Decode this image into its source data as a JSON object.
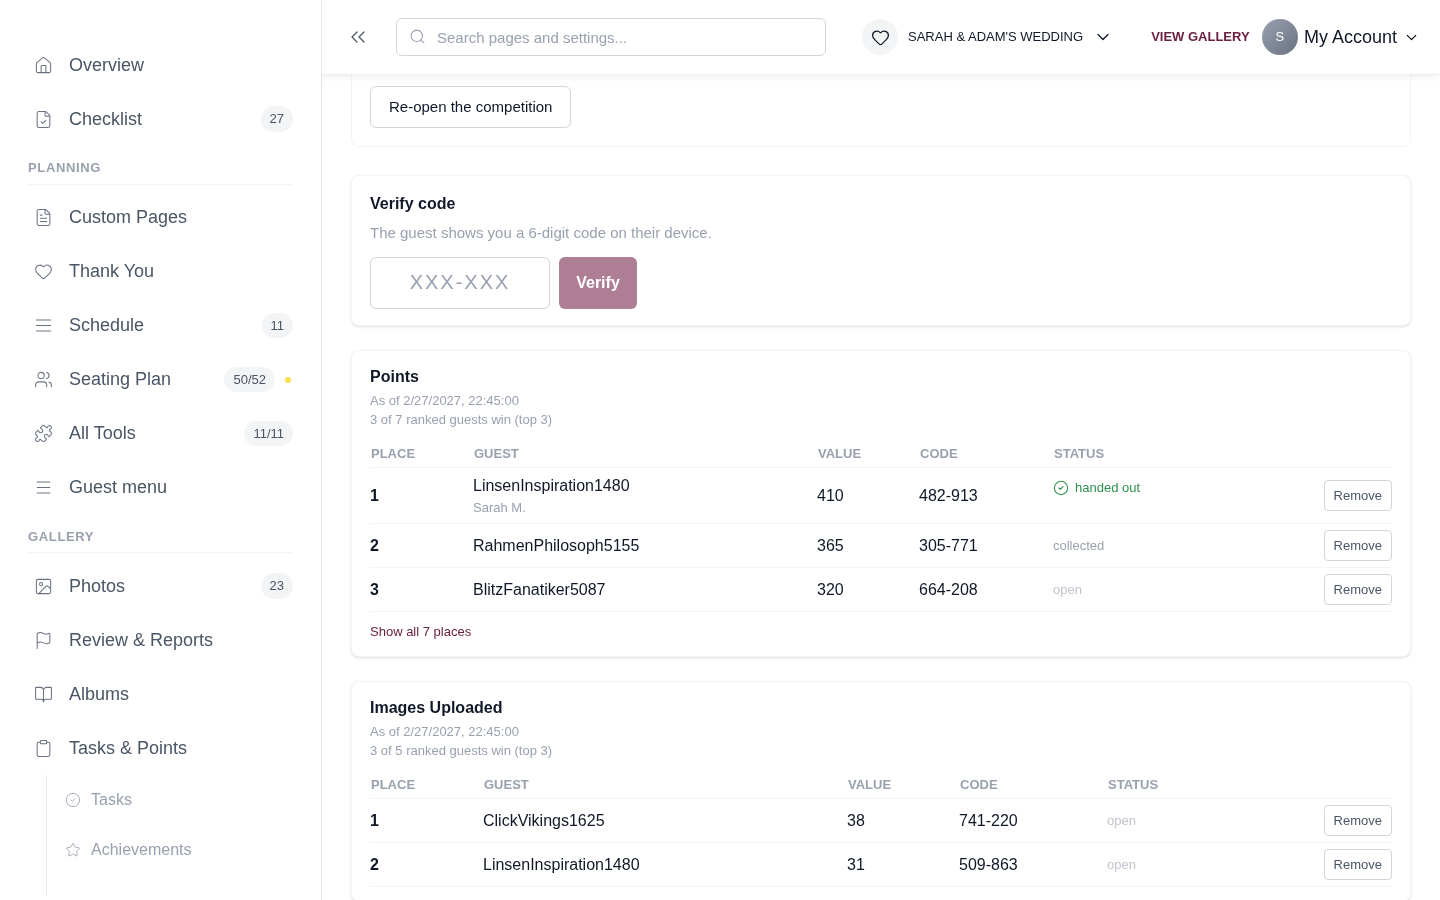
{
  "sidebar": {
    "sections": [
      {
        "items": [
          {
            "label": "Overview"
          },
          {
            "label": "Checklist",
            "badge": "27"
          }
        ]
      },
      {
        "title": "PLANNING",
        "items": [
          {
            "label": "Custom Pages"
          },
          {
            "label": "Thank You"
          },
          {
            "label": "Schedule",
            "badge": "11"
          },
          {
            "label": "Seating Plan",
            "badge": "50/52",
            "color": "#fde047"
          },
          {
            "label": "All Tools",
            "badge": "11/11"
          },
          {
            "label": "Guest menu"
          }
        ]
      },
      {
        "title": "GALLERY",
        "items": [
          {
            "label": "Photos",
            "badge": "23"
          },
          {
            "label": "Review & Reports"
          },
          {
            "label": "Albums"
          },
          {
            "label": "Tasks & Points",
            "children": [
              {
                "label": "Tasks"
              },
              {
                "label": "Achievements"
              }
            ]
          }
        ]
      }
    ]
  },
  "header": {
    "search_placeholder": "Search pages and settings...",
    "event": "SARAH & ADAM'S WEDDING",
    "view_gallery": "VIEW GALLERY",
    "avatar_initial": "S",
    "account": "My Account"
  },
  "competition": {
    "reopen_button": "Re-open the competition"
  },
  "verify": {
    "title": "Verify code",
    "description": "The guest shows you a 6-digit code on their device.",
    "placeholder": "XXX-XXX",
    "button": "Verify"
  },
  "leaderboards": [
    {
      "title": "Points",
      "as_of": "As of 2/27/2027, 22:45:00",
      "summary": "3 of 7 ranked guests win (top 3)",
      "columns": [
        "PLACE",
        "GUEST",
        "VALUE",
        "CODE",
        "STATUS"
      ],
      "rows": [
        {
          "place": "1",
          "guest": "LinsenInspiration1480",
          "guest_note": "Sarah M.",
          "value": "410",
          "code": "482-913",
          "status": "handed out",
          "checked": true,
          "color": "#2f8f4e",
          "action": "Remove"
        },
        {
          "place": "2",
          "guest": "RahmenPhilosoph5155",
          "value": "365",
          "code": "305-771",
          "status": "collected",
          "checked": false,
          "color": "#9ca3af",
          "action": "Remove"
        },
        {
          "place": "3",
          "guest": "BlitzFanatiker5087",
          "value": "320",
          "code": "664-208",
          "status": "open",
          "checked": false,
          "color": "#c0c4cb",
          "action": "Remove"
        }
      ],
      "show_all": "Show all 7 places"
    },
    {
      "title": "Images Uploaded",
      "as_of": "As of 2/27/2027, 22:45:00",
      "summary": "3 of 5 ranked guests win (top 3)",
      "columns": [
        "PLACE",
        "GUEST",
        "VALUE",
        "CODE",
        "STATUS"
      ],
      "rows": [
        {
          "place": "1",
          "guest": "ClickVikings1625",
          "value": "38",
          "code": "741-220",
          "status": "open",
          "checked": false,
          "color": "#c0c4cb",
          "action": "Remove"
        },
        {
          "place": "2",
          "guest": "LinsenInspiration1480",
          "value": "31",
          "code": "509-863",
          "status": "open",
          "checked": false,
          "color": "#c0c4cb",
          "action": "Remove"
        }
      ]
    }
  ]
}
